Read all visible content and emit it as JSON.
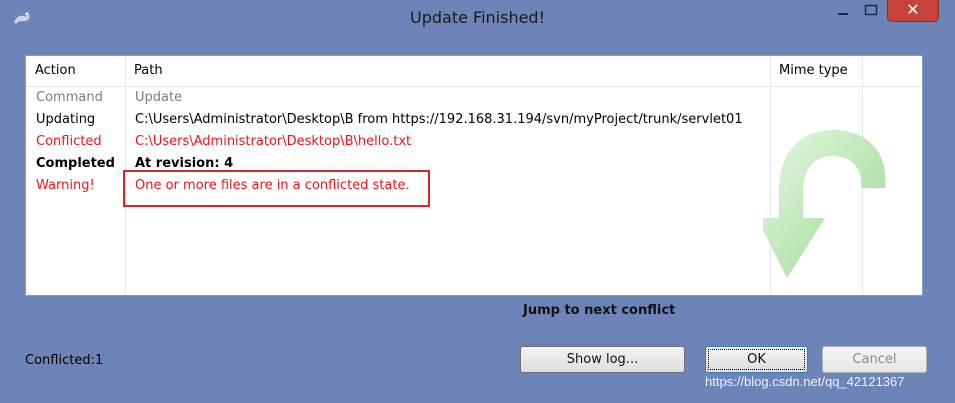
{
  "window": {
    "title": "Update Finished!"
  },
  "list": {
    "columns": [
      "Action",
      "Path",
      "Mime type"
    ],
    "rows": [
      {
        "action": "Command",
        "path": "Update",
        "color": "#7c7c7c",
        "bold": false
      },
      {
        "action": "Updating",
        "path": "C:\\Users\\Administrator\\Desktop\\B from https://192.168.31.194/svn/myProject/trunk/servlet01",
        "color": "#000000",
        "bold": false
      },
      {
        "action": "Conflicted",
        "path": "C:\\Users\\Administrator\\Desktop\\B\\hello.txt",
        "color": "#e8161b",
        "bold": false
      },
      {
        "action": "Completed",
        "path": "At revision: 4",
        "color": "#000000",
        "bold": true
      },
      {
        "action": "Warning!",
        "path": "One or more files are in a conflicted state.",
        "color": "#e8161b",
        "bold": false
      }
    ]
  },
  "jump_label": "Jump to next conflict",
  "status_text": "Conflicted:1",
  "buttons": {
    "show_log": "Show log...",
    "ok": "OK",
    "cancel": "Cancel"
  },
  "watermark": "https://blog.csdn.net/qq_42121367",
  "colors": {
    "accent_red": "#e8161b",
    "highlight_box": "#d4262c",
    "close_button": "#c7423a",
    "arrow_green": "#7fd27a"
  },
  "icons": {
    "app": "tortoise-svn-icon",
    "close": "close-icon",
    "minimize": "minimize-icon",
    "maximize": "maximize-icon",
    "watermark_graphic": "green-update-arrow-icon"
  }
}
